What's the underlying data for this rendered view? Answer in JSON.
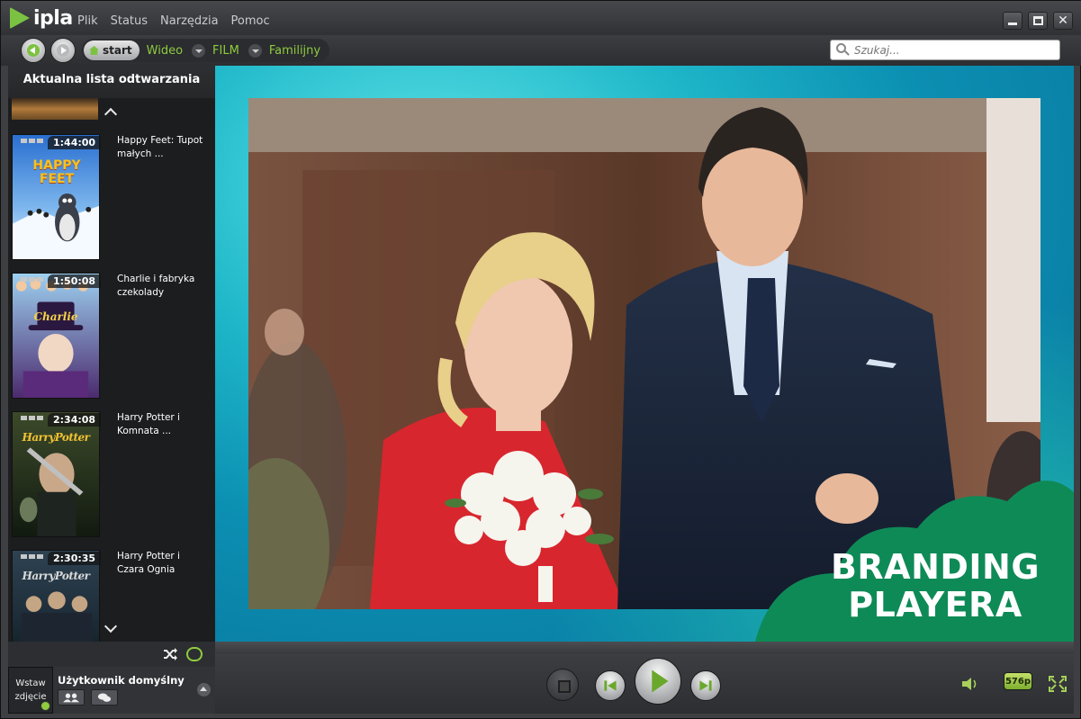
{
  "app": {
    "logo_text": "ipla"
  },
  "menu": [
    "Plik",
    "Status",
    "Narzędzia",
    "Pomoc"
  ],
  "nav": {
    "start_label": "start",
    "crumbs": [
      "Wideo",
      "FILM",
      "Familijny"
    ]
  },
  "search": {
    "placeholder": "Szukaj..."
  },
  "sidebar": {
    "title": "Aktualna lista odtwarzania",
    "items": [
      {
        "duration": "1:44:00",
        "title": "Happy Feet: Tupot małych ...",
        "poster_text": "HAPPY FEET"
      },
      {
        "duration": "1:50:08",
        "title": "Charlie i fabryka czekolady",
        "poster_text": "Charlie"
      },
      {
        "duration": "2:34:08",
        "title": "Harry Potter i Komnata ...",
        "poster_text": "HarryPotter"
      },
      {
        "duration": "2:30:35",
        "title": "Harry Potter i Czara Ognia",
        "poster_text": "HarryPotter"
      }
    ]
  },
  "user": {
    "avatar_label": "Wstaw zdjęcie",
    "name": "Użytkownik domyślny"
  },
  "video": {
    "branding_text": "BRANDING PLAYERA"
  },
  "controls": {
    "quality": "576p"
  },
  "colors": {
    "accent": "#7cc242",
    "crumb": "#8fcb3f",
    "stage": "#1fb7c9",
    "branding": "#0e8a57"
  },
  "icons": [
    "ipla-logo-icon",
    "back-arrow-icon",
    "forward-arrow-icon",
    "home-icon",
    "search-icon",
    "shuffle-icon",
    "repeat-icon",
    "friends-icon",
    "chat-icon",
    "stop-icon",
    "previous-icon",
    "play-icon",
    "next-icon",
    "volume-icon",
    "fullscreen-icon"
  ]
}
